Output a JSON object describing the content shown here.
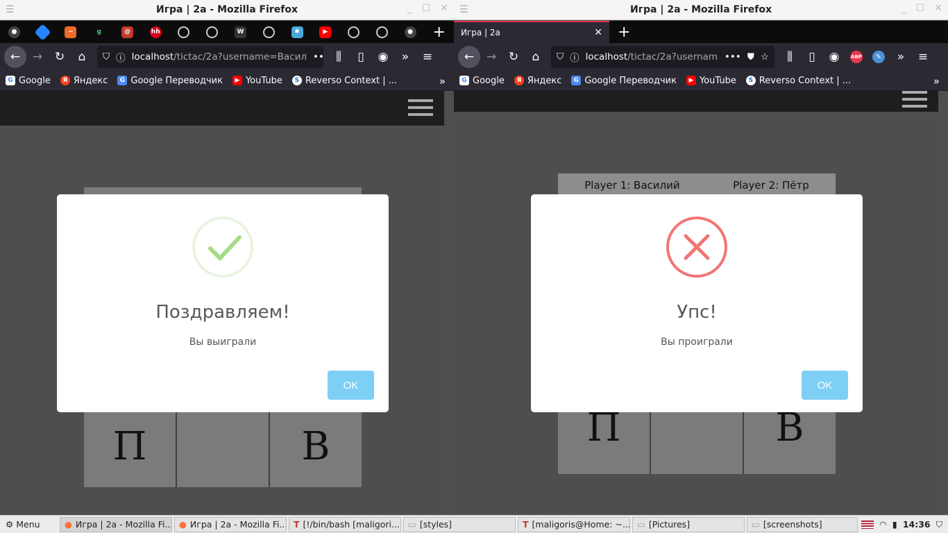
{
  "left": {
    "title": "Игра | 2a - Mozilla Firefox",
    "url_host": "localhost",
    "url_path": "/tictac/2a?username=Васил",
    "modal": {
      "title": "Поздравляем!",
      "text": "Вы выиграли",
      "ok": "OK",
      "icon": "check-icon",
      "color": "#a5dc86"
    },
    "cells": {
      "left": "П",
      "right": "В"
    }
  },
  "right": {
    "title": "Игра | 2a - Mozilla Firefox",
    "tab_title": "Игра | 2a",
    "url_host": "localhost",
    "url_path": "/tictac/2a?usernam",
    "players": {
      "p1": "Player 1: Василий",
      "p2": "Player 2: Пётр"
    },
    "modal": {
      "title": "Упс!",
      "text": "Вы проиграли",
      "ok": "OK",
      "icon": "error-x-icon",
      "color": "#f27474"
    },
    "cells": {
      "left": "П",
      "right": "В"
    }
  },
  "bookmarks": [
    {
      "label": "Google",
      "icon": "google-icon",
      "color": "#4285f4"
    },
    {
      "label": "Яндекс",
      "icon": "yandex-icon",
      "color": "#fc3f1d"
    },
    {
      "label": "Google Переводчик",
      "icon": "translate-icon",
      "color": "#4a8af4"
    },
    {
      "label": "YouTube",
      "icon": "youtube-icon",
      "color": "#ff0000"
    },
    {
      "label": "Reverso Context | ...",
      "icon": "reverso-icon",
      "color": "#1f6fd1"
    }
  ],
  "taskbar": {
    "menu": "Menu",
    "items": [
      "Игра | 2a - Mozilla Fi...",
      "Игра | 2a - Mozilla Fi...",
      "[!/bin/bash [maligori...",
      "[styles]",
      "[maligoris@Home: ~...",
      "[Pictures]",
      "[screenshots]"
    ],
    "clock": "14:36"
  }
}
